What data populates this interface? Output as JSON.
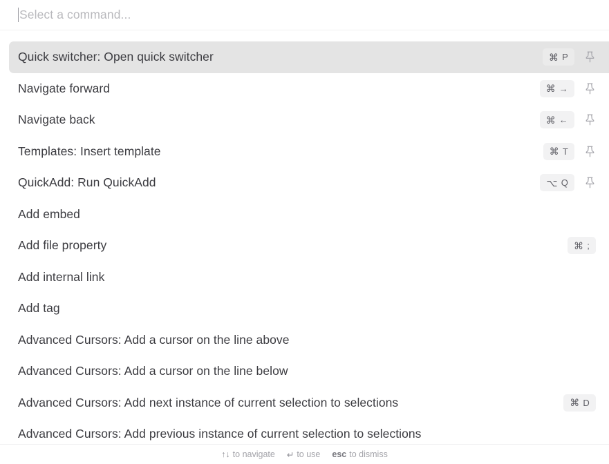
{
  "search": {
    "placeholder": "Select a command...",
    "value": ""
  },
  "colors": {
    "selected_row_bg": "#e4e4e4",
    "kbd_bg": "#f2f2f3",
    "text": "#3c3c41",
    "placeholder": "#b9b9bd",
    "footer_text": "#a3a3a9",
    "divider": "#f0f0f1"
  },
  "commands": [
    {
      "label": "Quick switcher: Open quick switcher",
      "selected": true,
      "shortcut": {
        "mod": "⌘",
        "key": "P"
      },
      "pin": true,
      "pin_icon": "pin-icon"
    },
    {
      "label": "Navigate forward",
      "selected": false,
      "shortcut": {
        "mod": "⌘",
        "key": "→"
      },
      "pin": true,
      "pin_icon": "pin-icon"
    },
    {
      "label": "Navigate back",
      "selected": false,
      "shortcut": {
        "mod": "⌘",
        "key": "←"
      },
      "pin": true,
      "pin_icon": "pin-icon"
    },
    {
      "label": "Templates: Insert template",
      "selected": false,
      "shortcut": {
        "mod": "⌘",
        "key": "T"
      },
      "pin": true,
      "pin_icon": "pin-icon"
    },
    {
      "label": "QuickAdd: Run QuickAdd",
      "selected": false,
      "shortcut": {
        "mod": "⌥",
        "key": "Q"
      },
      "pin": true,
      "pin_icon": "pin-icon"
    },
    {
      "label": "Add embed",
      "selected": false,
      "shortcut": null,
      "pin": false
    },
    {
      "label": "Add file property",
      "selected": false,
      "shortcut": {
        "mod": "⌘",
        "key": ";"
      },
      "pin": false
    },
    {
      "label": "Add internal link",
      "selected": false,
      "shortcut": null,
      "pin": false
    },
    {
      "label": "Add tag",
      "selected": false,
      "shortcut": null,
      "pin": false
    },
    {
      "label": "Advanced Cursors: Add a cursor on the line above",
      "selected": false,
      "shortcut": null,
      "pin": false
    },
    {
      "label": "Advanced Cursors: Add a cursor on the line below",
      "selected": false,
      "shortcut": null,
      "pin": false
    },
    {
      "label": "Advanced Cursors: Add next instance of current selection to selections",
      "selected": false,
      "shortcut": {
        "mod": "⌘",
        "key": "D"
      },
      "pin": false
    },
    {
      "label": "Advanced Cursors: Add previous instance of current selection to selections",
      "selected": false,
      "shortcut": null,
      "pin": false
    }
  ],
  "footer": {
    "navigate_symbol": "↑↓",
    "navigate_text": "to navigate",
    "use_symbol": "↵",
    "use_text": "to use",
    "dismiss_key": "esc",
    "dismiss_text": "to dismiss"
  }
}
